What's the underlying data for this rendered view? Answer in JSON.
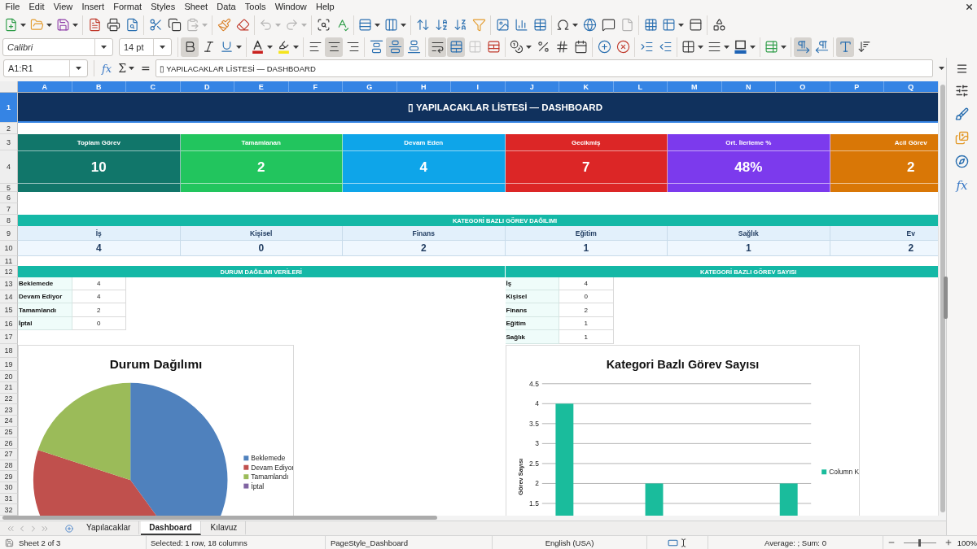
{
  "menu_bar": [
    "File",
    "Edit",
    "View",
    "Insert",
    "Format",
    "Styles",
    "Sheet",
    "Data",
    "Tools",
    "Window",
    "Help"
  ],
  "standard_toolbar": [
    {
      "buttons": [
        {
          "kind": "new",
          "dropdown": true,
          "disabled": false
        },
        {
          "kind": "open",
          "dropdown": true,
          "disabled": false
        },
        {
          "kind": "save",
          "dropdown": true,
          "disabled": false
        }
      ]
    },
    {
      "buttons": [
        {
          "kind": "export-pdf",
          "dropdown": false,
          "disabled": false
        },
        {
          "kind": "print",
          "dropdown": false,
          "disabled": false
        },
        {
          "kind": "print-preview",
          "dropdown": false,
          "disabled": false
        }
      ]
    },
    {
      "buttons": [
        {
          "kind": "cut",
          "dropdown": false,
          "disabled": false
        },
        {
          "kind": "copy",
          "dropdown": false,
          "disabled": false
        },
        {
          "kind": "paste",
          "dropdown": true,
          "disabled": true
        }
      ]
    },
    {
      "buttons": [
        {
          "kind": "clone-formatting",
          "dropdown": false,
          "disabled": false
        },
        {
          "kind": "clear-formatting",
          "dropdown": false,
          "disabled": false
        }
      ]
    },
    {
      "buttons": [
        {
          "kind": "undo",
          "dropdown": true,
          "disabled": true
        },
        {
          "kind": "redo",
          "dropdown": true,
          "disabled": true
        }
      ]
    },
    {
      "buttons": [
        {
          "kind": "find-replace",
          "dropdown": false,
          "disabled": false
        },
        {
          "kind": "spelling",
          "dropdown": false,
          "disabled": false
        }
      ]
    },
    {
      "buttons": [
        {
          "kind": "row",
          "dropdown": true,
          "disabled": false
        },
        {
          "kind": "column",
          "dropdown": true,
          "disabled": false
        }
      ]
    },
    {
      "buttons": [
        {
          "kind": "sort",
          "dropdown": false,
          "disabled": false
        },
        {
          "kind": "sort-ascending",
          "dropdown": false,
          "disabled": false
        },
        {
          "kind": "sort-descending",
          "dropdown": false,
          "disabled": false
        },
        {
          "kind": "autofilter",
          "dropdown": false,
          "disabled": false
        }
      ]
    },
    {
      "buttons": [
        {
          "kind": "image",
          "dropdown": false,
          "disabled": false
        },
        {
          "kind": "chart",
          "dropdown": false,
          "disabled": false
        },
        {
          "kind": "pivot-table",
          "dropdown": false,
          "disabled": false
        }
      ]
    },
    {
      "buttons": [
        {
          "kind": "special-character",
          "dropdown": true,
          "disabled": false
        },
        {
          "kind": "hyperlink",
          "dropdown": false,
          "disabled": false
        },
        {
          "kind": "comment",
          "dropdown": false,
          "disabled": false
        },
        {
          "kind": "header-footer",
          "dropdown": false,
          "disabled": true
        }
      ]
    },
    {
      "buttons": [
        {
          "kind": "print-area",
          "dropdown": false,
          "disabled": false
        },
        {
          "kind": "freeze",
          "dropdown": true,
          "disabled": false
        },
        {
          "kind": "split-window",
          "dropdown": false,
          "disabled": false
        }
      ]
    },
    {
      "buttons": [
        {
          "kind": "draw-functions",
          "dropdown": false,
          "disabled": false
        }
      ]
    }
  ],
  "formatting_toolbar": {
    "font_name": "Calibri",
    "font_size": "14 pt",
    "groups": [
      {
        "buttons": [
          {
            "kind": "bold",
            "dropdown": false,
            "pressed": true,
            "disabled": false
          },
          {
            "kind": "italic",
            "dropdown": false,
            "pressed": false,
            "disabled": false
          },
          {
            "kind": "underline",
            "dropdown": true,
            "pressed": false,
            "disabled": false
          }
        ]
      },
      {
        "buttons": [
          {
            "kind": "font-color",
            "dropdown": true,
            "pressed": false,
            "disabled": false
          },
          {
            "kind": "highlight",
            "dropdown": true,
            "pressed": false,
            "disabled": false
          }
        ]
      },
      {
        "buttons": [
          {
            "kind": "align-left",
            "dropdown": false,
            "pressed": false,
            "disabled": false
          },
          {
            "kind": "align-center",
            "dropdown": false,
            "pressed": true,
            "disabled": false
          },
          {
            "kind": "align-right",
            "dropdown": false,
            "pressed": false,
            "disabled": false
          }
        ]
      },
      {
        "buttons": [
          {
            "kind": "align-top",
            "dropdown": false,
            "pressed": false,
            "disabled": false
          },
          {
            "kind": "align-middle",
            "dropdown": false,
            "pressed": true,
            "disabled": false
          },
          {
            "kind": "align-bottom",
            "dropdown": false,
            "pressed": false,
            "disabled": false
          }
        ]
      },
      {
        "buttons": [
          {
            "kind": "wrap-text",
            "dropdown": false,
            "pressed": true,
            "disabled": false
          },
          {
            "kind": "merge-center",
            "dropdown": false,
            "pressed": true,
            "disabled": false
          },
          {
            "kind": "merge-cells",
            "dropdown": false,
            "pressed": false,
            "disabled": true
          },
          {
            "kind": "unmerge-cells",
            "dropdown": false,
            "pressed": false,
            "disabled": false
          }
        ]
      },
      {
        "buttons": [
          {
            "kind": "currency",
            "dropdown": true,
            "pressed": false,
            "disabled": false
          },
          {
            "kind": "percent",
            "dropdown": false,
            "pressed": false,
            "disabled": false
          },
          {
            "kind": "number-format",
            "dropdown": false,
            "pressed": false,
            "disabled": false
          },
          {
            "kind": "date-format",
            "dropdown": false,
            "pressed": false,
            "disabled": false
          }
        ]
      },
      {
        "buttons": [
          {
            "kind": "add-decimal",
            "dropdown": false,
            "pressed": false,
            "disabled": false
          },
          {
            "kind": "delete-decimal",
            "dropdown": false,
            "pressed": false,
            "disabled": false
          }
        ]
      },
      {
        "buttons": [
          {
            "kind": "increase-indent",
            "dropdown": false,
            "pressed": false,
            "disabled": false
          },
          {
            "kind": "decrease-indent",
            "dropdown": false,
            "pressed": false,
            "disabled": false
          }
        ]
      },
      {
        "buttons": [
          {
            "kind": "borders",
            "dropdown": true,
            "pressed": false,
            "disabled": false
          },
          {
            "kind": "border-style",
            "dropdown": true,
            "pressed": false,
            "disabled": false
          },
          {
            "kind": "border-color",
            "dropdown": true,
            "pressed": false,
            "disabled": false
          }
        ]
      },
      {
        "buttons": [
          {
            "kind": "conditional-format",
            "dropdown": true,
            "pressed": false,
            "disabled": false
          }
        ]
      },
      {
        "buttons": [
          {
            "kind": "left-to-right",
            "dropdown": false,
            "pressed": true,
            "disabled": false
          },
          {
            "kind": "right-to-left",
            "dropdown": false,
            "pressed": false,
            "disabled": false
          }
        ]
      },
      {
        "buttons": [
          {
            "kind": "text-direction",
            "dropdown": false,
            "pressed": true,
            "disabled": false
          },
          {
            "kind": "vertical-text",
            "dropdown": false,
            "pressed": false,
            "disabled": false
          }
        ]
      }
    ]
  },
  "formula_bar": {
    "name_box": "A1:R1",
    "function_wizard": "fx",
    "sum": "Σ",
    "formula": "=",
    "value": "▯ YAPILACAKLAR LİSTESİ — DASHBOARD"
  },
  "sidebar": {
    "functions": "fx"
  },
  "sheet": {
    "column_headers": [
      {
        "label": "A",
        "selected": true
      },
      {
        "label": "B",
        "selected": true
      },
      {
        "label": "C",
        "selected": true
      },
      {
        "label": "D",
        "selected": true
      },
      {
        "label": "E",
        "selected": true
      },
      {
        "label": "F",
        "selected": true
      },
      {
        "label": "G",
        "selected": true
      },
      {
        "label": "H",
        "selected": true
      },
      {
        "label": "I",
        "selected": true
      },
      {
        "label": "J",
        "selected": true
      },
      {
        "label": "K",
        "selected": true
      },
      {
        "label": "L",
        "selected": true
      },
      {
        "label": "M",
        "selected": true
      },
      {
        "label": "N",
        "selected": true
      },
      {
        "label": "O",
        "selected": true
      },
      {
        "label": "P",
        "selected": true
      },
      {
        "label": "Q",
        "selected": true
      }
    ],
    "row_headers": [
      {
        "label": "1",
        "selected": true
      },
      {
        "label": "2",
        "selected": false
      },
      {
        "label": "3",
        "selected": false
      },
      {
        "label": "4",
        "selected": false
      },
      {
        "label": "5",
        "selected": false
      },
      {
        "label": "6",
        "selected": false
      },
      {
        "label": "7",
        "selected": false
      },
      {
        "label": "8",
        "selected": false
      },
      {
        "label": "9",
        "selected": false
      },
      {
        "label": "10",
        "selected": false
      },
      {
        "label": "11",
        "selected": false
      },
      {
        "label": "12",
        "selected": false
      },
      {
        "label": "13",
        "selected": false
      },
      {
        "label": "14",
        "selected": false
      },
      {
        "label": "15",
        "selected": false
      },
      {
        "label": "16",
        "selected": false
      },
      {
        "label": "17",
        "selected": false
      },
      {
        "label": "18",
        "selected": false
      },
      {
        "label": "19",
        "selected": false
      },
      {
        "label": "20",
        "selected": false
      },
      {
        "label": "21",
        "selected": false
      },
      {
        "label": "22",
        "selected": false
      },
      {
        "label": "23",
        "selected": false
      },
      {
        "label": "24",
        "selected": false
      },
      {
        "label": "25",
        "selected": false
      },
      {
        "label": "26",
        "selected": false
      },
      {
        "label": "27",
        "selected": false
      },
      {
        "label": "28",
        "selected": false
      },
      {
        "label": "29",
        "selected": false
      },
      {
        "label": "30",
        "selected": false
      },
      {
        "label": "31",
        "selected": false
      },
      {
        "label": "32",
        "selected": false
      }
    ],
    "title": {
      "text": "▯ YAPILACAKLAR LİSTESİ — DASHBOARD",
      "selected": true
    },
    "kpis": [
      {
        "label": "Toplam Görev",
        "value": "10",
        "color": "#11766a"
      },
      {
        "label": "Tamamlanan",
        "value": "2",
        "color": "#22c55e"
      },
      {
        "label": "Devam Eden",
        "value": "4",
        "color": "#0ea5e9"
      },
      {
        "label": "Gecikmiş",
        "value": "7",
        "color": "#dc2626"
      },
      {
        "label": "Ort. İlerleme %",
        "value": "48%",
        "color": "#7c3aed"
      },
      {
        "label": "Acil Görev",
        "value": "2",
        "color": "#d97706"
      }
    ],
    "category_distribution": {
      "title": "KATEGORİ BAZLI GÖREV DAĞILIMI",
      "categories": [
        {
          "name": "İş",
          "count": "4"
        },
        {
          "name": "Kişisel",
          "count": "0"
        },
        {
          "name": "Finans",
          "count": "2"
        },
        {
          "name": "Eğitim",
          "count": "1"
        },
        {
          "name": "Sağlık",
          "count": "1"
        },
        {
          "name": "Ev",
          "count": "2"
        }
      ]
    },
    "status_data": {
      "title": "DURUM DAĞILIMI VERİLERİ",
      "rows": [
        {
          "label": "Beklemede",
          "value": "4"
        },
        {
          "label": "Devam Ediyor",
          "value": "4"
        },
        {
          "label": "Tamamlandı",
          "value": "2"
        },
        {
          "label": "İptal",
          "value": "0"
        }
      ]
    },
    "category_counts": {
      "title": "KATEGORİ BAZLI GÖREV SAYISI",
      "rows": [
        {
          "label": "İş",
          "value": "4"
        },
        {
          "label": "Kişisel",
          "value": "0"
        },
        {
          "label": "Finans",
          "value": "2"
        },
        {
          "label": "Eğitim",
          "value": "1"
        },
        {
          "label": "Sağlık",
          "value": "1"
        }
      ]
    },
    "charts": [
      {
        "chart_data": {
          "type": "pie",
          "title": "Durum Dağılımı",
          "categories": [
            "Beklemede",
            "Devam Ediyor",
            "Tamamlandı",
            "İptal"
          ],
          "values": [
            40,
            40,
            20,
            0
          ],
          "legend": "right"
        }
      },
      {
        "chart_data": {
          "type": "bar",
          "title": "Kategori Bazlı Görev Sayısı",
          "ylabel": "Görev Sayısı",
          "series": [
            {
              "name": "Column K",
              "color": "#1abc9c",
              "values": [
                4,
                null,
                2,
                null,
                null,
                2
              ]
            }
          ],
          "ylim": [
            0,
            4.5
          ],
          "yticks": [
            1.5,
            2,
            2.5,
            3,
            3.5,
            4,
            4.5
          ],
          "grid": true,
          "legend": "right"
        }
      }
    ]
  },
  "sheet_tabs": [
    {
      "label": "Yapılacaklar",
      "selected": false
    },
    {
      "label": "Dashboard",
      "selected": true
    },
    {
      "label": "Kılavuz",
      "selected": false
    }
  ],
  "status_bar": {
    "sheet": "Sheet 2 of 3",
    "selection": "Selected: 1 row, 18 columns",
    "page_style": "PageStyle_Dashboard",
    "language": "English (USA)",
    "summary": "Average: ; Sum: 0",
    "zoom": {
      "level": 0.5,
      "reading": "100%"
    }
  }
}
